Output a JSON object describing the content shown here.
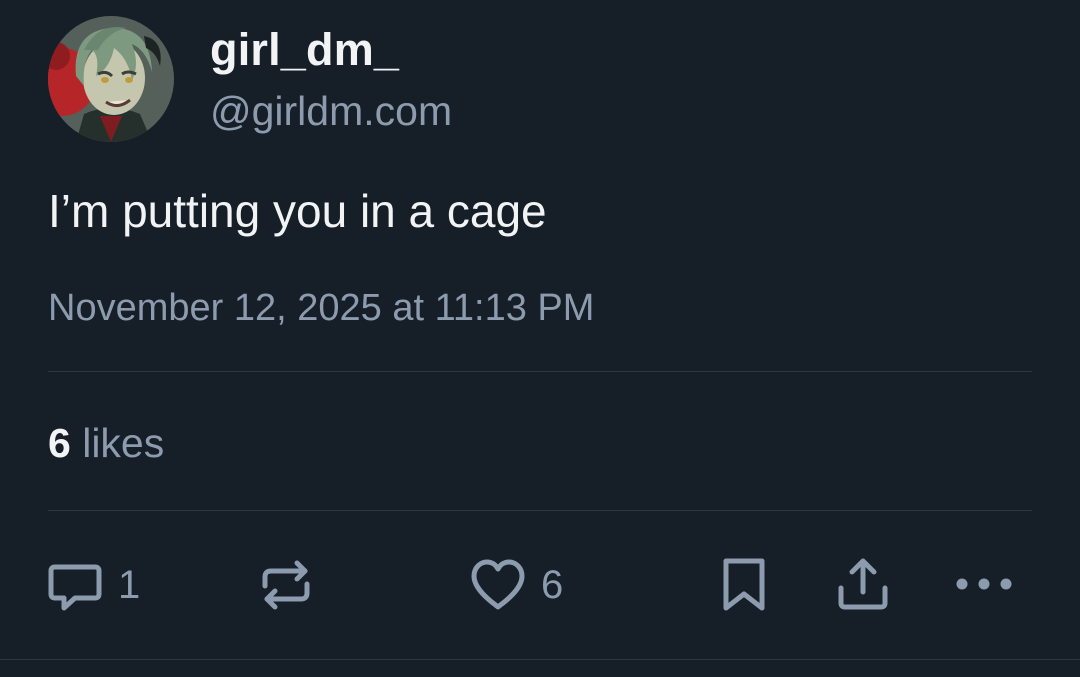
{
  "author": {
    "display_name": "girl_dm_",
    "handle": "@girldm.com",
    "avatar_icon": "avatar-anime-character"
  },
  "post": {
    "text": "I’m putting you in a cage",
    "timestamp": "November 12, 2025 at 11:13 PM"
  },
  "stats": {
    "likes_count": "6",
    "likes_label": "likes"
  },
  "actions": {
    "reply_count": "1",
    "like_count": "6",
    "icons": [
      "reply-icon",
      "repost-icon",
      "heart-icon",
      "bookmark-icon",
      "share-icon",
      "more-icon"
    ]
  },
  "colors": {
    "background": "#161e27",
    "primary_text": "#f1f3f5",
    "secondary_text": "#8c9bad",
    "divider": "#2c3744"
  }
}
